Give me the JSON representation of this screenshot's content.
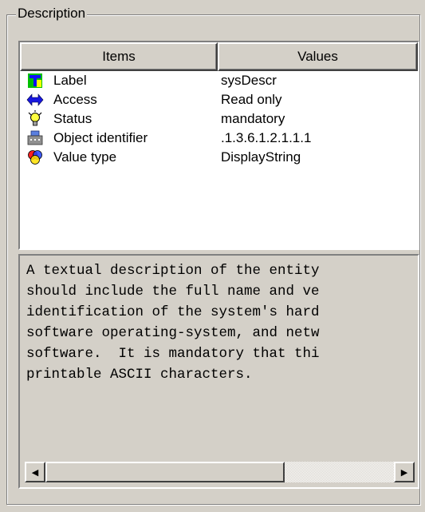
{
  "group": {
    "title": "Description"
  },
  "table": {
    "headers": {
      "items": "Items",
      "values": "Values"
    },
    "rows": [
      {
        "icon": "label-icon",
        "label": "Label",
        "value": "sysDescr"
      },
      {
        "icon": "access-arrows-icon",
        "label": "Access",
        "value": "Read only"
      },
      {
        "icon": "lightbulb-icon",
        "label": "Status",
        "value": "mandatory"
      },
      {
        "icon": "object-identifier-icon",
        "label": "Object identifier",
        "value": ".1.3.6.1.2.1.1.1"
      },
      {
        "icon": "value-type-circles-icon",
        "label": "Value type",
        "value": "DisplayString"
      }
    ]
  },
  "description": {
    "lines": [
      "A textual description of the entity",
      "should include the full name and ve",
      "identification of the system's hard",
      "software operating-system, and netw",
      "software.  It is mandatory that thi",
      "printable ASCII characters."
    ]
  },
  "scrollbar": {
    "left_arrow": "◀",
    "right_arrow": "▶"
  }
}
